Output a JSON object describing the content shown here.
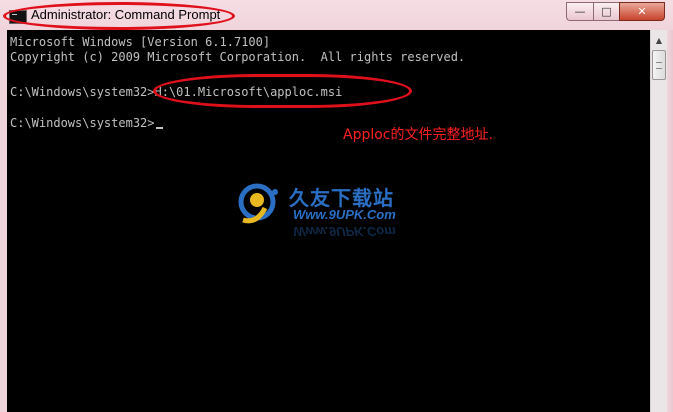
{
  "window": {
    "title": "Administrator: Command Prompt",
    "icon": "cmd-console-icon",
    "buttons": {
      "minimize": "—",
      "maximize": "□",
      "close": "✕"
    }
  },
  "console": {
    "lines": [
      "Microsoft Windows [Version 6.1.7100]",
      "Copyright (c) 2009 Microsoft Corporation.  All rights reserved.",
      "C:\\Windows\\system32>H:\\01.Microsoft\\apploc.msi",
      "C:\\Windows\\system32>"
    ]
  },
  "annotation": {
    "text": "Apploc的文件完整地址.",
    "color": "#ff2020"
  },
  "watermark": {
    "name": "久友下载站",
    "url": "Www.9UPK.Com",
    "color": "#2a6fc4"
  },
  "scrollbar": {
    "up_arrow": "▲"
  },
  "colors": {
    "highlight_ellipse": "#e0101a",
    "console_bg": "#000000",
    "console_text": "#c0c0c0"
  }
}
